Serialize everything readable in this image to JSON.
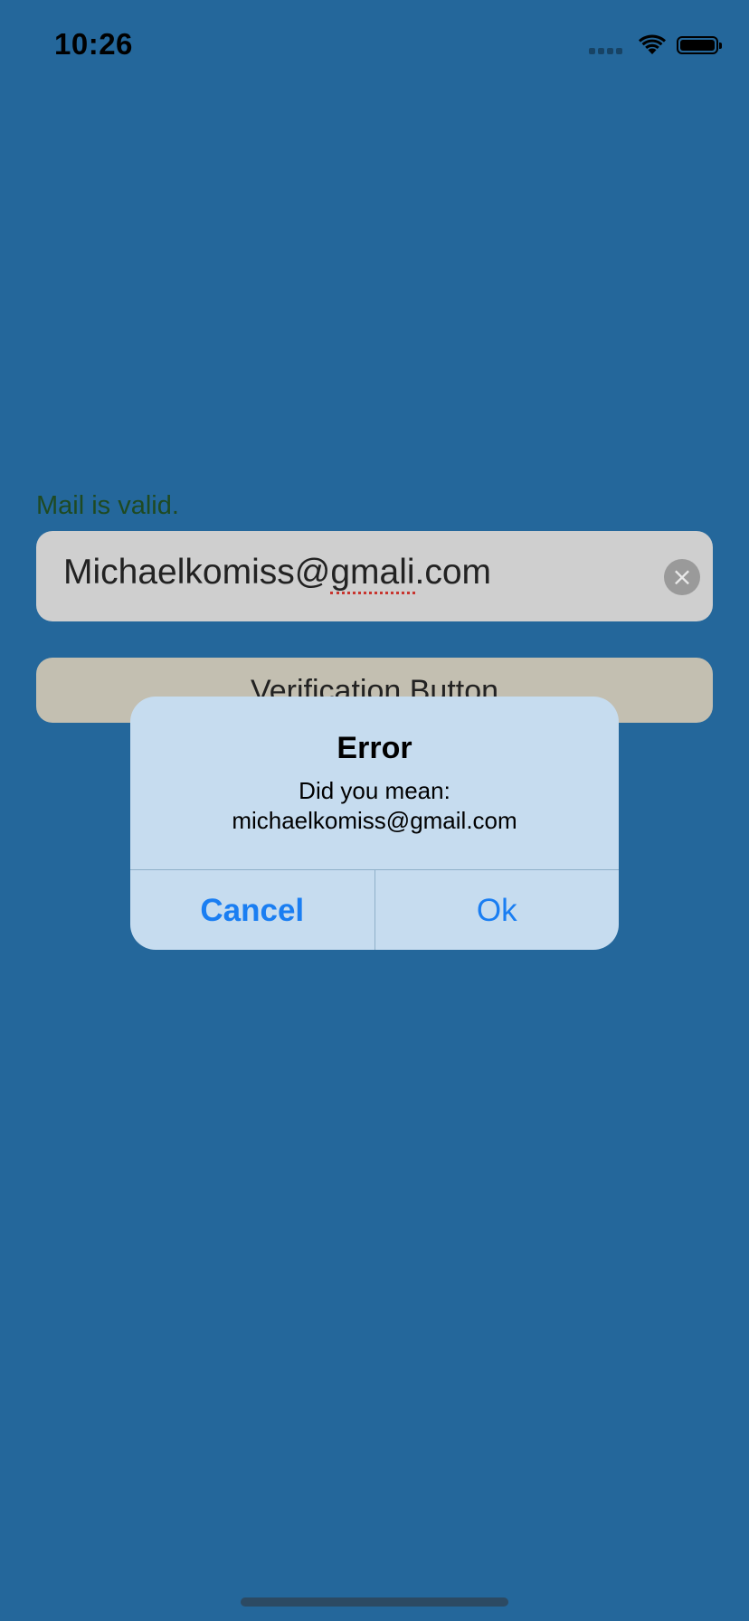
{
  "status_bar": {
    "time": "10:26"
  },
  "form": {
    "validation_message": "Mail is valid.",
    "email_value_prefix": "Michaelkomiss@",
    "email_value_misspelled": "gmali",
    "email_value_suffix": ".com",
    "clear_icon": "×",
    "verify_button_label": "Verification Button"
  },
  "alert": {
    "title": "Error",
    "message_line1": "Did you mean:",
    "message_line2": "michaelkomiss@gmail.com",
    "cancel_label": "Cancel",
    "ok_label": "Ok"
  },
  "colors": {
    "background": "#24679b",
    "alert_button": "#1a7ef2",
    "valid_text": "#1f4a22"
  },
  "icons": [
    "signal-icon",
    "wifi-icon",
    "battery-icon",
    "clear-icon"
  ]
}
